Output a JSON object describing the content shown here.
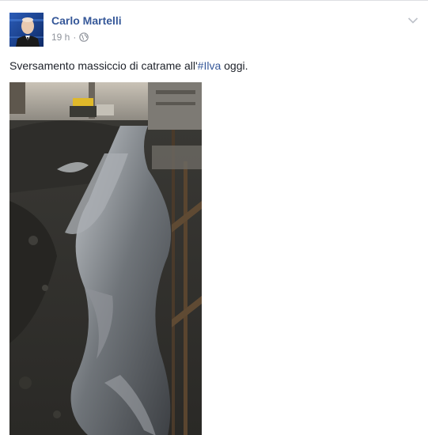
{
  "post": {
    "author_name": "Carlo Martelli",
    "timestamp": "19 h",
    "separator": "·",
    "privacy_icon": "globe-icon",
    "options_icon": "chevron-down-icon",
    "text_before": "Sversamento massiccio di catrame all'",
    "hashtag": "#Ilva",
    "text_after": " oggi.",
    "photo_description_icon": "photo"
  },
  "colors": {
    "link": "#365899",
    "text": "#1d2129",
    "meta": "#90949c",
    "border": "#dddfe2"
  }
}
